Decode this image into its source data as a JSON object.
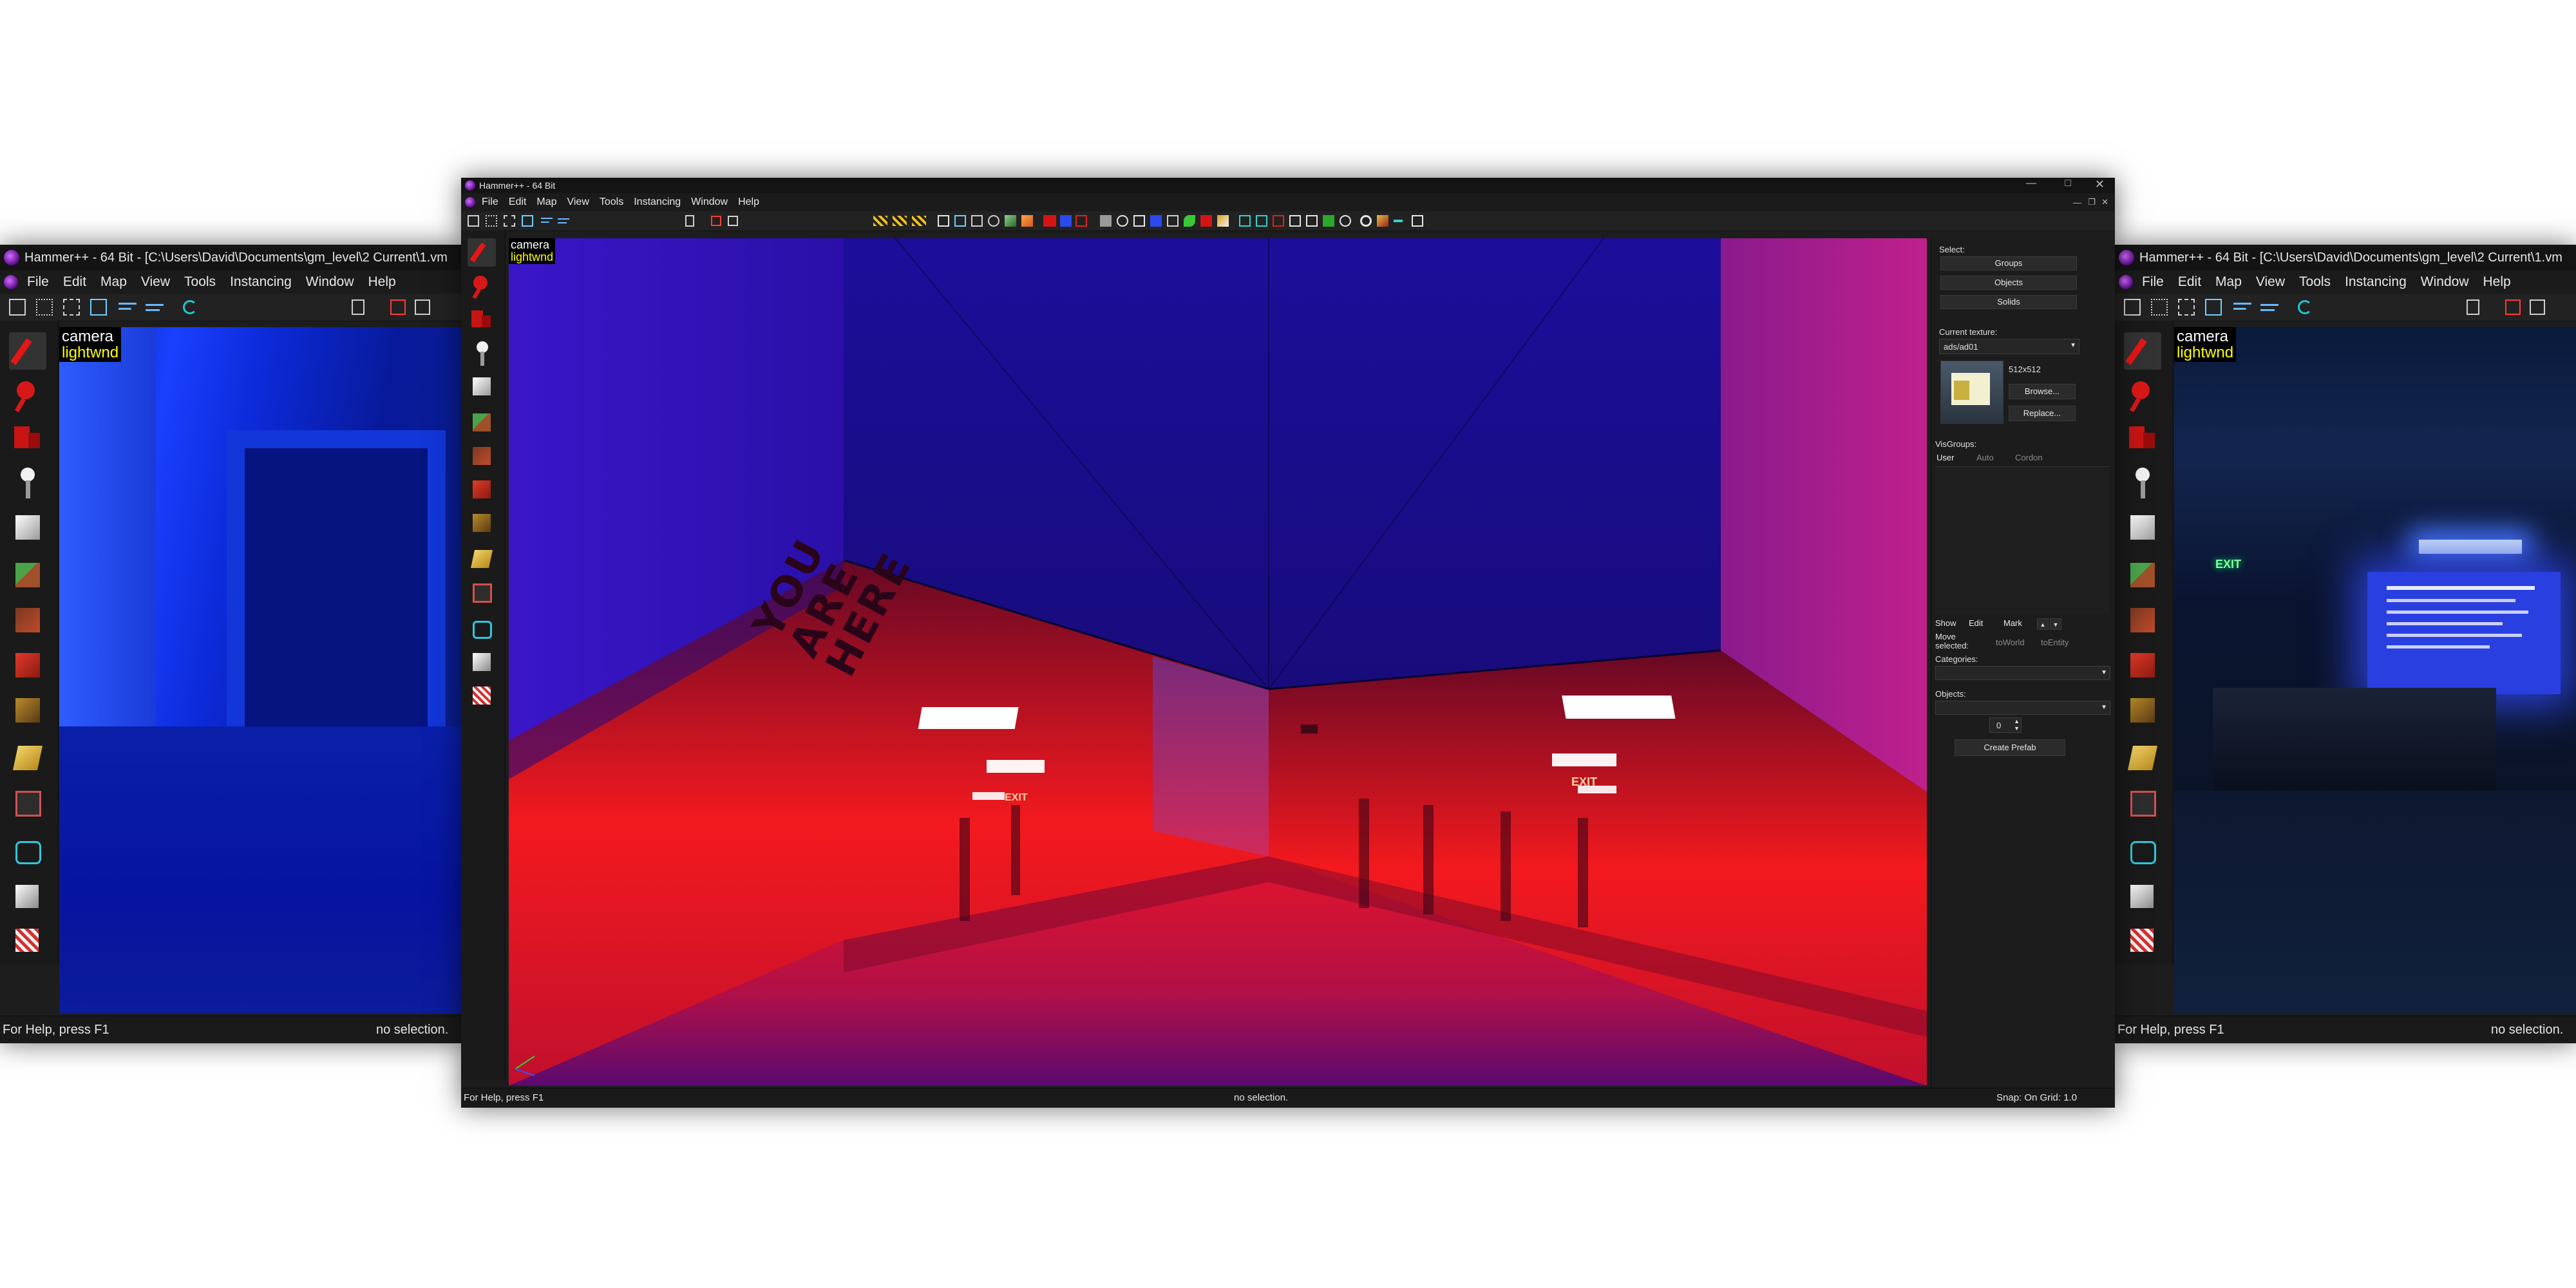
{
  "left_window": {
    "title": "Hammer++ - 64 Bit - [C:\\Users\\David\\Documents\\gm_level\\2 Current\\1.vm",
    "menu": [
      "File",
      "Edit",
      "Map",
      "View",
      "Tools",
      "Instancing",
      "Window",
      "Help"
    ],
    "viewport": {
      "camera_label": "camera",
      "render_label": "lightwnd"
    },
    "status": {
      "help": "For Help, press F1",
      "selection": "no selection."
    }
  },
  "main_window": {
    "title": "Hammer++ - 64 Bit",
    "menu": [
      "File",
      "Edit",
      "Map",
      "View",
      "Tools",
      "Instancing",
      "Window",
      "Help"
    ],
    "viewport": {
      "camera_label": "camera",
      "render_label": "lightwnd",
      "wall_text": "YOU ARE HERE",
      "exit_sign": "EXIT"
    },
    "panel": {
      "select_label": "Select:",
      "groups": "Groups",
      "objects_btn": "Objects",
      "solids": "Solids",
      "current_texture_label": "Current texture:",
      "texture_value": "ads/ad01",
      "texture_size": "512x512",
      "browse": "Browse...",
      "replace": "Replace...",
      "visgroups_label": "VisGroups:",
      "tabs": [
        "User",
        "Auto",
        "Cordon"
      ],
      "show": "Show",
      "edit": "Edit",
      "mark": "Mark",
      "move_selected": "Move selected:",
      "to_world": "toWorld",
      "to_entity": "toEntity",
      "categories_label": "Categories:",
      "objects_label": "Objects:",
      "count_value": "0",
      "create_prefab": "Create Prefab"
    },
    "status": {
      "help": "For Help, press F1",
      "selection": "no selection.",
      "snap": "Snap: On Grid: 1.0"
    }
  },
  "right_window": {
    "title": "Hammer++ - 64 Bit - [C:\\Users\\David\\Documents\\gm_level\\2 Current\\1.vm",
    "menu": [
      "File",
      "Edit",
      "Map",
      "View",
      "Tools",
      "Instancing",
      "Window",
      "Help"
    ],
    "viewport": {
      "camera_label": "camera",
      "render_label": "lightwnd",
      "exit_sign": "EXIT"
    },
    "status": {
      "help": "For Help, press F1",
      "selection": "no selection."
    }
  },
  "tool_icons": [
    "selection-tool-icon",
    "magnify-tool-icon",
    "camera-tool-icon",
    "entity-tool-icon",
    "block-tool-icon",
    "texture-tool-icon",
    "apply-texture-icon",
    "decal-tool-icon",
    "overlay-tool-icon",
    "clip-tool-icon",
    "vertex-tool-icon",
    "path-tool-icon",
    "cordon-tool-icon",
    "sprinkle-tool-icon"
  ]
}
